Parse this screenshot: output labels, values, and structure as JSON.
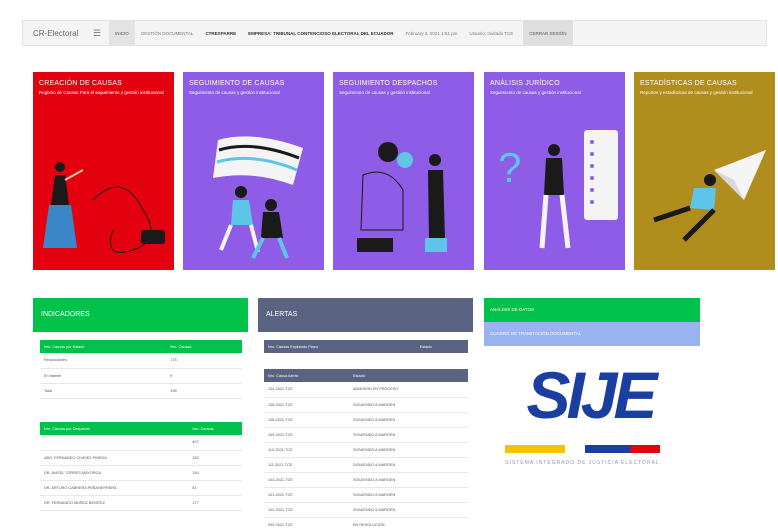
{
  "topbar": {
    "brand": "CR-Electoral",
    "nav": [
      "INICIO",
      "GESTIÓN DOCUMENTAL",
      "CTRESPARRE",
      "EMPRESA: TRIBUNAL CONTENCIOSO ELECTORAL DEL ECUADOR",
      "February 3, 2021 1:51 pm",
      "Usuario: Invitado TCE"
    ],
    "logout": "CERRAR SESIÓN"
  },
  "cards": [
    {
      "title": "CREACIÓN DE CAUSAS",
      "desc": "Registro de Causas Para el seguimiento y gestión institucional",
      "color": "#e3000f",
      "icon": "woman-typewriter-illustration"
    },
    {
      "title": "SEGUIMIENTO DE CAUSAS",
      "desc": "Seguimiento de causas y gestión institucional",
      "color": "#8e5ce6",
      "icon": "people-flag-illustration"
    },
    {
      "title": "SEGUIMIENTO DESPACHOS",
      "desc": "Seguimiento de causas y gestión institucional",
      "color": "#8e5ce6",
      "icon": "meeting-illustration"
    },
    {
      "title": "ANÁLISIS JURÍDICO",
      "desc": "Seguimiento de causas y gestión institucional",
      "color": "#8e5ce6",
      "icon": "question-checklist-illustration"
    },
    {
      "title": "ESTADÍSTICAS DE CAUSAS",
      "desc": "Reportes y estadísticas de causas y gestión institucional",
      "color": "#b18d1e",
      "icon": "paper-plane-illustration"
    }
  ],
  "indicators": {
    "title": "INDICADORES",
    "table1": {
      "headers": [
        "Nro. Causas por Estado",
        "Nro. Causas"
      ],
      "rows": [
        [
          "Resoluciones",
          "178"
        ],
        [
          "En trámite",
          "9"
        ],
        [
          "Total",
          "198"
        ]
      ]
    },
    "table2": {
      "headers": [
        "Nro. Causas por Despacho",
        "Nro. Causas"
      ],
      "rows": [
        [
          "-",
          "407"
        ],
        [
          "ABG. FERNANDO CHAVEZ PINEDA",
          "282"
        ],
        [
          "DR. ANGEL TORRES MAYORGA",
          "154"
        ],
        [
          "DR. ARTURO CABRERA PEÑAHERRERA",
          "81"
        ],
        [
          "DR. FERNANDO MUÑOZ BENITEZ",
          "177"
        ]
      ]
    }
  },
  "alerts": {
    "title": "ALERTAS",
    "table1": {
      "headers": [
        "Nro. Causas Expirando Plazo",
        "Estado"
      ]
    },
    "table2": {
      "headers": [
        "Nro. Causa Alerta",
        "Estado"
      ],
      "rows": [
        [
          "104-2021-TCE",
          "ADMISIÓN EN PROCESO"
        ],
        [
          "106-2021-TCE",
          "SIGUIENDO A MARGEN"
        ],
        [
          "108-2021-TCE",
          "SIGUIENDO A MARGEN"
        ],
        [
          "109-2021-TCE",
          "SIGUIENDO A MARGEN"
        ],
        [
          "110-2021-TCE",
          "SIGUIENDO A MARGEN"
        ],
        [
          "111-2021-TCE",
          "SIGUIENDO A MARGEN"
        ],
        [
          "103-2021-TCE",
          "SIGUIENDO A MARGEN"
        ],
        [
          "101-2021-TCE",
          "SIGUIENDO A MARGEN"
        ],
        [
          "102-2021-TCE",
          "SIGUIENDO A MARGEN"
        ],
        [
          "099-2021-TCE",
          "EN RESOLUCIÓN"
        ]
      ]
    }
  },
  "side": {
    "green": "ANÁLISIS DE DATOS",
    "blue": "CUADRO DE TRAMITACIÓN DOCUMENTAL"
  },
  "logo": {
    "wordmark": "SIJE",
    "caption": "SISTEMA INTEGRADO DE JUSTICIA ELECTORAL",
    "colors": [
      "#f2c500",
      "#1a3fa0",
      "#e3000f"
    ]
  }
}
